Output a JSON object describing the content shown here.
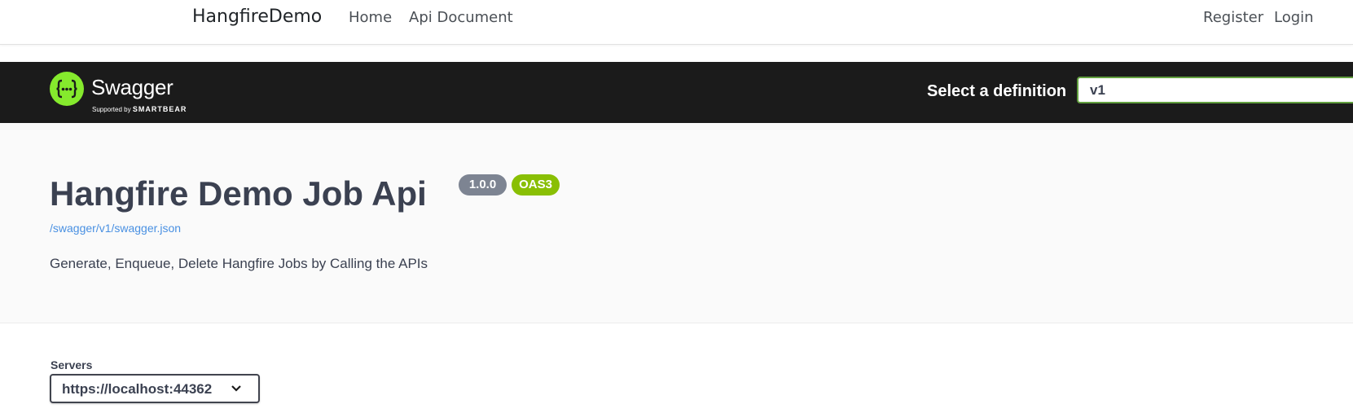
{
  "topnav": {
    "brand": "HangfireDemo",
    "links": [
      "Home",
      "Api Document"
    ],
    "register": "Register",
    "login": "Login"
  },
  "swagger_bar": {
    "logo_text": "Swagger",
    "logo_supported_by": "Supported by",
    "logo_company": "SMARTBEAR",
    "select_label": "Select a definition",
    "select_value": "v1"
  },
  "info": {
    "title": "Hangfire Demo Job Api",
    "version_badge": "1.0.0",
    "oas_badge": "OAS3",
    "json_link": "/swagger/v1/swagger.json",
    "description": "Generate, Enqueue, Delete Hangfire Jobs by Calling the APIs"
  },
  "servers": {
    "label": "Servers",
    "selected": "https://localhost:44362"
  },
  "colors": {
    "swagger_green": "#85ea2d",
    "bar_bg": "#1b1b1b",
    "oas_badge": "#89bf04",
    "version_badge": "#7d8492",
    "link": "#4990e2"
  },
  "icons": [
    "swagger-logo-icon",
    "chevron-down-icon"
  ]
}
